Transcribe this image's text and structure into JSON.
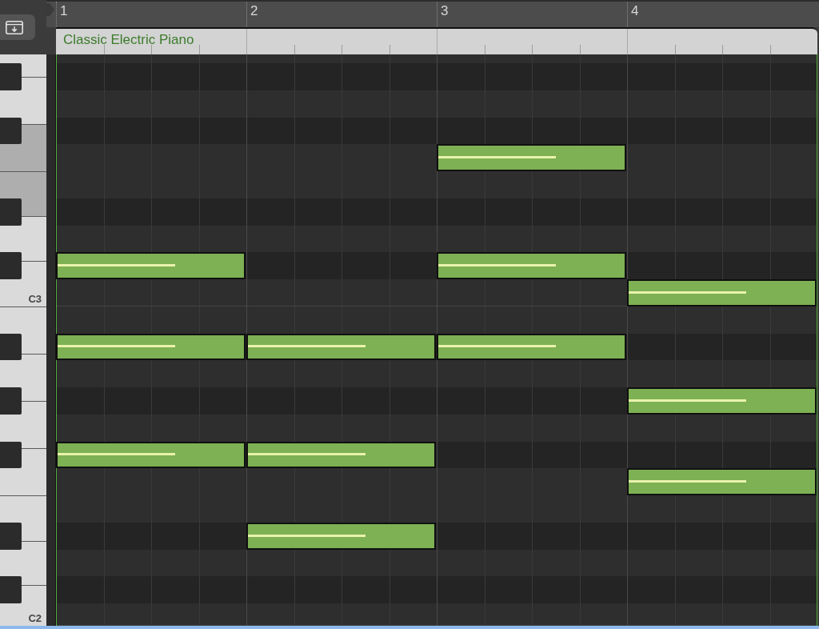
{
  "ruler": {
    "bars": [
      "1",
      "2",
      "3",
      "4"
    ]
  },
  "region": {
    "title": "Classic Electric Piano"
  },
  "rows": [
    {
      "kind": "white",
      "highlighted": false,
      "bars": [
        {
          "note": false
        },
        {
          "note": false
        },
        {
          "note": false
        },
        {
          "note": false
        }
      ]
    },
    {
      "kind": "black",
      "highlighted": false,
      "bars": [
        {
          "note": false
        },
        {
          "note": false
        },
        {
          "note": false
        },
        {
          "note": false
        }
      ]
    },
    {
      "kind": "white",
      "highlighted": false,
      "bars": [
        {
          "note": false
        },
        {
          "note": false
        },
        {
          "note": false
        },
        {
          "note": false
        }
      ]
    },
    {
      "kind": "black",
      "highlighted": false,
      "bars": [
        {
          "note": false
        },
        {
          "note": false
        },
        {
          "note": false
        },
        {
          "note": false
        }
      ]
    },
    {
      "kind": "white",
      "highlighted": true,
      "bars": [
        {
          "note": false
        },
        {
          "note": false
        },
        {
          "note": true,
          "level": 0.63
        },
        {
          "note": false
        }
      ]
    },
    {
      "kind": "white",
      "highlighted": true,
      "bars": [
        {
          "note": false
        },
        {
          "note": false
        },
        {
          "note": false
        },
        {
          "note": false
        }
      ]
    },
    {
      "kind": "black",
      "highlighted": false,
      "bars": [
        {
          "note": false
        },
        {
          "note": false
        },
        {
          "note": false
        },
        {
          "note": false
        }
      ]
    },
    {
      "kind": "white",
      "highlighted": false,
      "bars": [
        {
          "note": false
        },
        {
          "note": false
        },
        {
          "note": false
        },
        {
          "note": false
        }
      ]
    },
    {
      "kind": "black",
      "highlighted": false,
      "bars": [
        {
          "note": true,
          "level": 0.63
        },
        {
          "note": false
        },
        {
          "note": true,
          "level": 0.63
        },
        {
          "note": false
        }
      ]
    },
    {
      "kind": "white",
      "label": "C3",
      "highlighted": false,
      "bars": [
        {
          "note": false
        },
        {
          "note": false
        },
        {
          "note": false
        },
        {
          "note": true,
          "level": 0.63
        }
      ]
    },
    {
      "kind": "white",
      "highlighted": false,
      "bars": [
        {
          "note": false
        },
        {
          "note": false
        },
        {
          "note": false
        },
        {
          "note": false
        }
      ]
    },
    {
      "kind": "black",
      "highlighted": false,
      "bars": [
        {
          "note": true,
          "level": 0.63
        },
        {
          "note": true,
          "level": 0.63
        },
        {
          "note": true,
          "level": 0.63
        },
        {
          "note": false
        }
      ]
    },
    {
      "kind": "white",
      "highlighted": false,
      "bars": [
        {
          "note": false
        },
        {
          "note": false
        },
        {
          "note": false
        },
        {
          "note": false
        }
      ]
    },
    {
      "kind": "black",
      "highlighted": false,
      "bars": [
        {
          "note": false
        },
        {
          "note": false
        },
        {
          "note": false
        },
        {
          "note": true,
          "level": 0.63
        }
      ]
    },
    {
      "kind": "white",
      "highlighted": false,
      "bars": [
        {
          "note": false
        },
        {
          "note": false
        },
        {
          "note": false
        },
        {
          "note": false
        }
      ]
    },
    {
      "kind": "black",
      "highlighted": false,
      "bars": [
        {
          "note": true,
          "level": 0.63
        },
        {
          "note": true,
          "level": 0.63
        },
        {
          "note": false
        },
        {
          "note": false
        }
      ]
    },
    {
      "kind": "white",
      "highlighted": false,
      "bars": [
        {
          "note": false
        },
        {
          "note": false
        },
        {
          "note": false
        },
        {
          "note": true,
          "level": 0.63
        }
      ]
    },
    {
      "kind": "white",
      "highlighted": false,
      "bars": [
        {
          "note": false
        },
        {
          "note": false
        },
        {
          "note": false
        },
        {
          "note": false
        }
      ]
    },
    {
      "kind": "black",
      "highlighted": false,
      "bars": [
        {
          "note": false
        },
        {
          "note": true,
          "level": 0.63
        },
        {
          "note": false
        },
        {
          "note": false
        }
      ]
    },
    {
      "kind": "white",
      "highlighted": false,
      "bars": [
        {
          "note": false
        },
        {
          "note": false
        },
        {
          "note": false
        },
        {
          "note": false
        }
      ]
    },
    {
      "kind": "black",
      "highlighted": false,
      "bars": [
        {
          "note": false
        },
        {
          "note": false
        },
        {
          "note": false
        },
        {
          "note": false
        }
      ]
    },
    {
      "kind": "white",
      "label": "C2",
      "highlighted": false,
      "bars": [
        {
          "note": false
        },
        {
          "note": false
        },
        {
          "note": false
        },
        {
          "note": false
        }
      ]
    }
  ]
}
